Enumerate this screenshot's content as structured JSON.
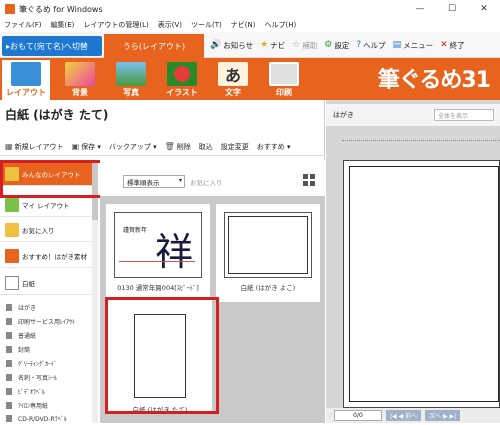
{
  "window": {
    "title": "筆ぐるめ for Windows",
    "minimize": "—",
    "maximize": "☐",
    "close": "✕"
  },
  "menu": [
    "ファイル(F)",
    "編集(E)",
    "レイアウトの管理(L)",
    "表示(V)",
    "ツール(T)",
    "ナビ(N)",
    "ヘルプ(H)"
  ],
  "toolbar": {
    "omote": "▸おもて(宛て名)へ切替",
    "ura": "うら(レイアウト)",
    "items": [
      {
        "icon": "speaker-icon",
        "glyph": "🔊",
        "label": "お知らせ"
      },
      {
        "icon": "star-icon",
        "glyph": "★",
        "label": "ナビ"
      },
      {
        "icon": "star-hollow-icon",
        "glyph": "☆",
        "label": "補助"
      },
      {
        "icon": "gear-icon",
        "glyph": "⚙",
        "label": "設定"
      },
      {
        "icon": "question-icon",
        "glyph": "?",
        "label": "ヘルプ"
      },
      {
        "icon": "menu-icon",
        "glyph": "▤",
        "label": "メニュー"
      },
      {
        "icon": "close-icon",
        "glyph": "✕",
        "label": "終了"
      }
    ]
  },
  "ribbon": {
    "tabs": [
      "レイアウト",
      "背景",
      "写真",
      "イラスト",
      "文字",
      "印刷"
    ],
    "active": "レイアウト",
    "brand": "筆ぐるめ31",
    "colors": {
      "accent": "#e8641e",
      "blue": "#1e78d2",
      "red": "#d42020"
    }
  },
  "main": {
    "heading": "白紙 (はがき たて)",
    "actions": [
      {
        "icon": "new-layout-icon",
        "label": "新規レイアウト"
      },
      {
        "icon": "save-icon",
        "label": "保存 ▾"
      },
      {
        "icon": "backup-icon",
        "label": "バックアップ ▾"
      },
      {
        "icon": "delete-icon",
        "label": "削除"
      },
      {
        "icon": "import-icon",
        "label": "取込"
      },
      {
        "icon": "settings-change-icon",
        "label": "設定変更"
      },
      {
        "icon": "recommend-icon",
        "label": "おすすめ ▾"
      }
    ],
    "filter": {
      "select": "標準順表示",
      "favorites": "お気に入り"
    },
    "thumbnails": [
      {
        "caption": "0130 通常年賀004[ｽﾋﾟｰﾄﾞ]",
        "greeting": "謹賀新年",
        "kanji": "祥"
      },
      {
        "caption": "白紙 (はがき よこ)"
      },
      {
        "caption": "白紙 (はがき たて)"
      }
    ]
  },
  "sidebar": {
    "categories": [
      "みんなのレイアウト",
      "マイ レイアウト",
      "お気に入り",
      "おすすめ！はがき素材",
      "白紙"
    ],
    "active": "みんなのレイアウト",
    "list": [
      "はがき",
      "印刷サービス用ﾚｲｱｳﾄ",
      "普通紙",
      "封筒",
      "ｸﾞﾘｰﾃｨﾝｸﾞｶｰﾄﾞ",
      "名刺・写真ｼｰﾙ",
      "ﾋﾞﾃﾞｵﾗﾍﾞﾙ",
      "ｱｲﾛﾝ専用紙",
      "CD-R/DVD-Rﾗﾍﾞﾙ"
    ]
  },
  "preview": {
    "label": "はがき",
    "select": "全体を表示",
    "page": "0/0",
    "prev": "|◀ ◀ 前へ",
    "next": "次へ ▶ ▶|"
  }
}
